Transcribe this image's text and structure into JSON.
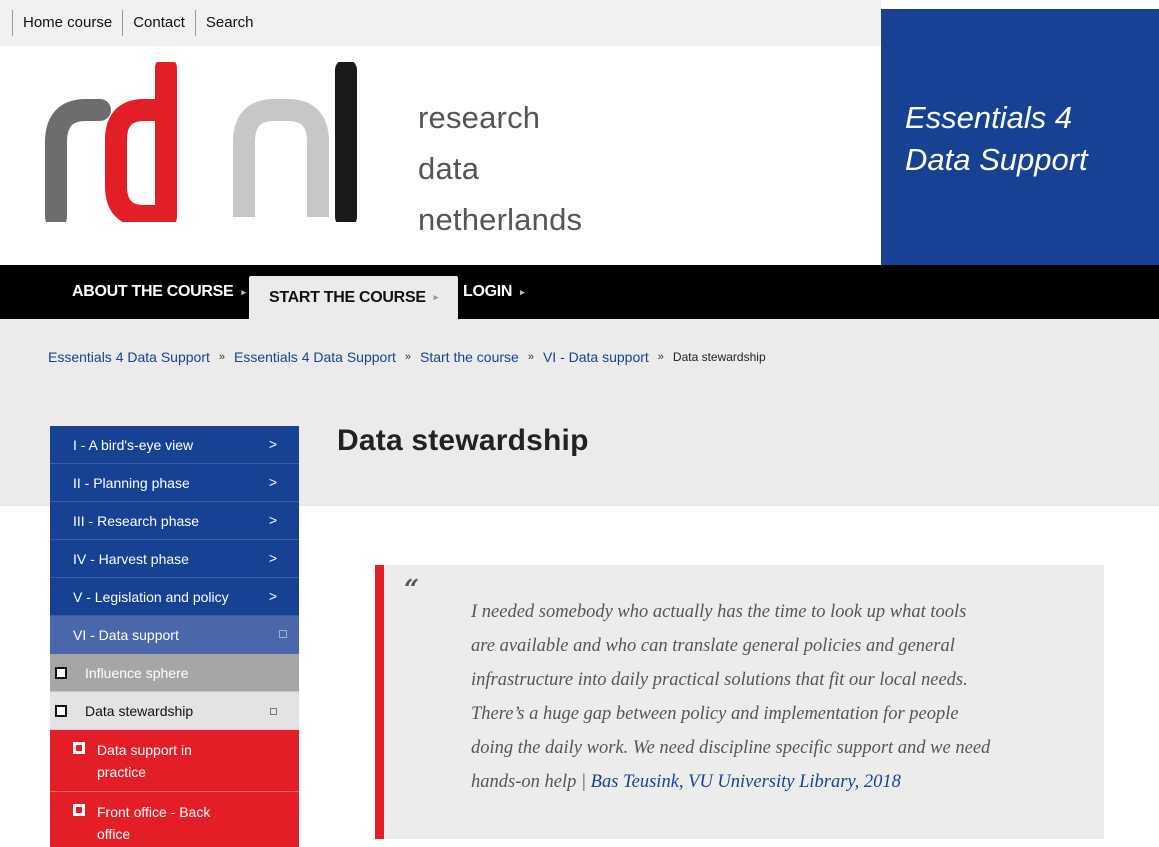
{
  "topbar": {
    "links": [
      "Home course",
      "Contact",
      "Search"
    ]
  },
  "header": {
    "logo_letters": "rdnl",
    "logo_text": [
      "research",
      "data",
      "netherlands"
    ],
    "brand_title": [
      "Essentials 4",
      "Data Support"
    ]
  },
  "nav": {
    "items": [
      {
        "label": "ABOUT THE COURSE",
        "active": false
      },
      {
        "label": "START THE COURSE",
        "active": true
      },
      {
        "label": "LOGIN",
        "active": false
      }
    ],
    "arrow": "▸"
  },
  "breadcrumb": {
    "items": [
      "Essentials 4 Data Support",
      "Essentials 4 Data Support",
      "Start the course",
      "VI - Data support"
    ],
    "current": "Data stewardship",
    "separator": "»"
  },
  "page": {
    "title": "Data stewardship"
  },
  "sidebar": {
    "items": [
      {
        "label": "I - A bird's-eye view",
        "chevron": ">"
      },
      {
        "label": "II - Planning phase",
        "chevron": ">"
      },
      {
        "label": "III - Research phase",
        "chevron": ">"
      },
      {
        "label": "IV - Harvest phase",
        "chevron": ">"
      },
      {
        "label": "V - Legislation and policy",
        "chevron": ">"
      },
      {
        "label": "VI - Data support"
      }
    ],
    "subitems": [
      {
        "label": "Influence sphere"
      },
      {
        "label": "Data stewardship"
      }
    ],
    "subsubitems": [
      {
        "label_lines": [
          "Data support in",
          "practice"
        ]
      },
      {
        "label_lines": [
          "Front office - Back",
          "office"
        ]
      }
    ]
  },
  "quote": {
    "mark": "“",
    "lines": [
      "I needed somebody who actually has the time to look up what tools",
      "are available and who can translate general policies and general",
      "infrastructure into daily practical solutions that fit our local needs.",
      "There’s a huge gap between policy and implementation for people",
      "doing the daily work. We need discipline specific support and we need"
    ],
    "last_line_prefix": "hands-on help | ",
    "attribution": "Bas Teusink, VU University Library, 2018"
  },
  "colors": {
    "brand_blue": "#174294",
    "accent_red": "#e41e26",
    "nav_black": "#000000",
    "band_grey": "#ebebeb"
  }
}
